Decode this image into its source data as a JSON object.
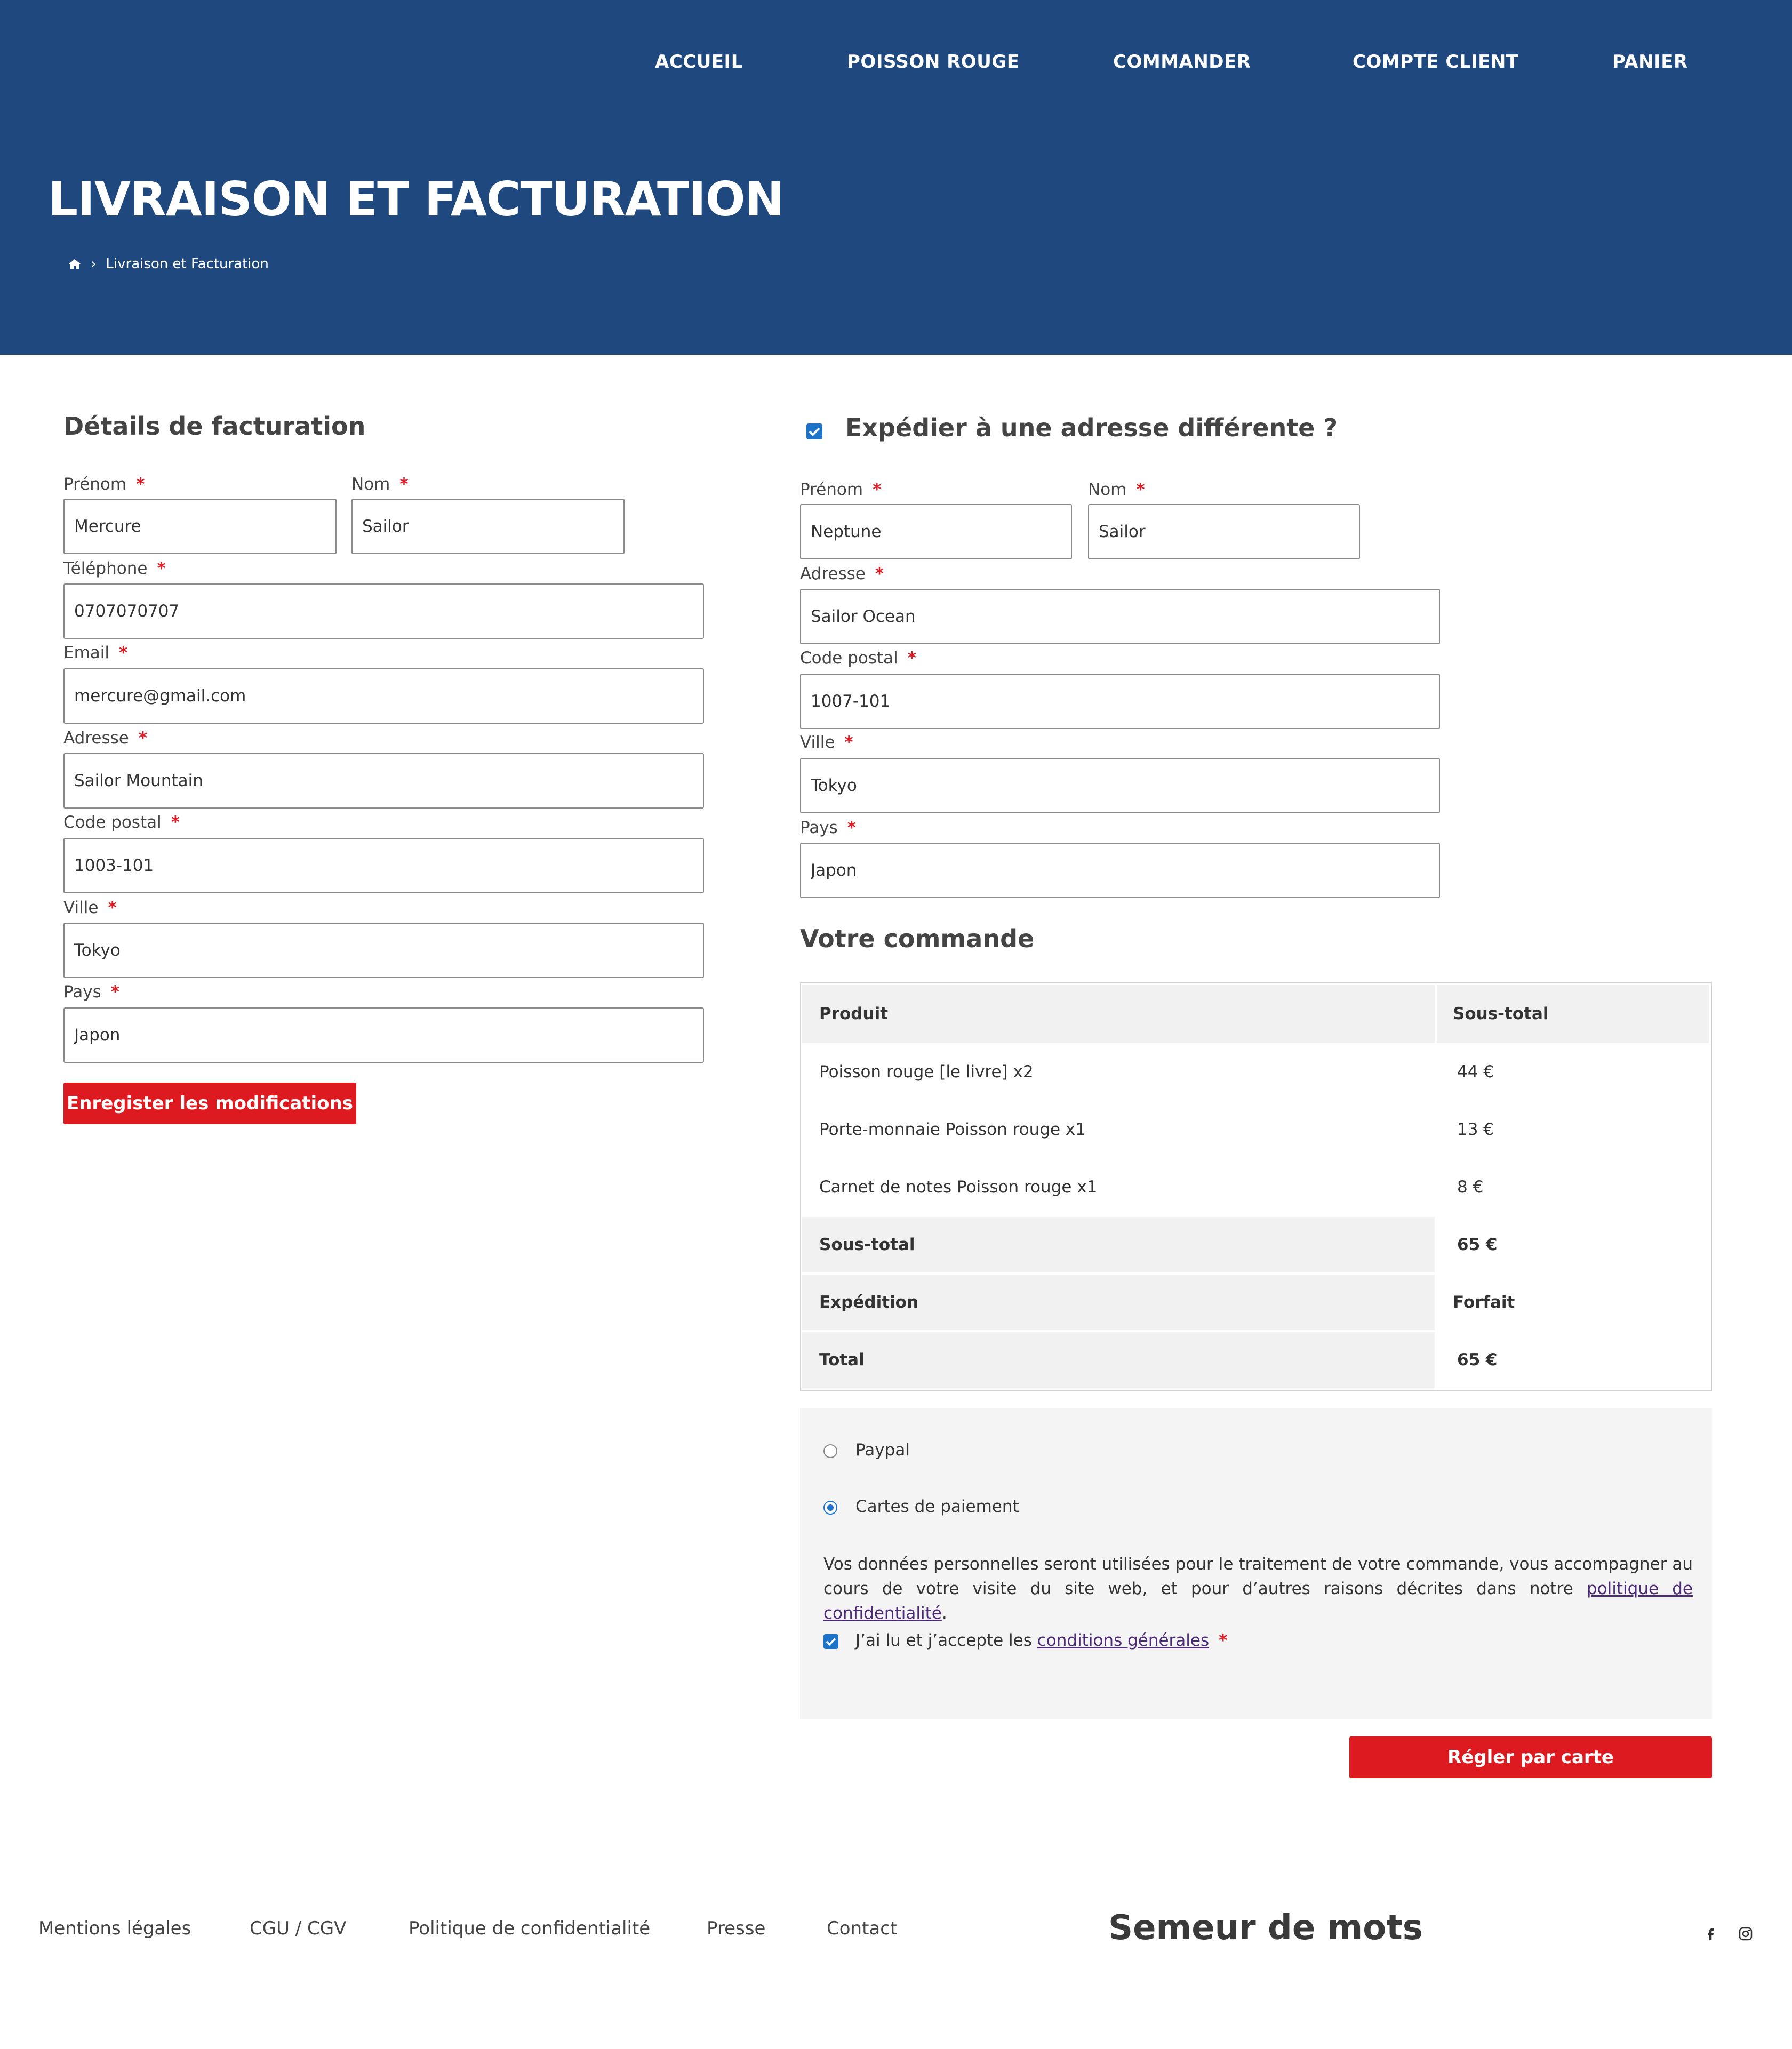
{
  "nav": {
    "items": [
      "ACCUEIL",
      "POISSON ROUGE",
      "COMMANDER",
      "COMPTE CLIENT",
      "PANIER"
    ]
  },
  "hero": {
    "title": "LIVRAISON ET FACTURATION",
    "breadcrumb_current": "Livraison et Facturation",
    "home_icon": "home-icon"
  },
  "billing": {
    "heading": "Détails de facturation",
    "required_mark": "*",
    "fields": {
      "prenom": {
        "label": "Prénom",
        "value": "Mercure"
      },
      "nom": {
        "label": "Nom",
        "value": "Sailor"
      },
      "telephone": {
        "label": "Téléphone",
        "value": "0707070707"
      },
      "email": {
        "label": "Email",
        "value": "mercure@gmail.com"
      },
      "adresse": {
        "label": "Adresse",
        "value": "Sailor Mountain"
      },
      "code_postal": {
        "label": "Code postal",
        "value": "1003-101"
      },
      "ville": {
        "label": "Ville",
        "value": "Tokyo"
      },
      "pays": {
        "label": "Pays",
        "value": "Japon"
      }
    },
    "save_button": "Enregister les modifications"
  },
  "shipping": {
    "heading": "Expédier à une adresse différente ?",
    "checked": true,
    "fields": {
      "prenom": {
        "label": "Prénom",
        "value": "Neptune"
      },
      "nom": {
        "label": "Nom",
        "value": "Sailor"
      },
      "adresse": {
        "label": "Adresse",
        "value": "Sailor Ocean"
      },
      "code_postal": {
        "label": "Code postal",
        "value": "1007-101"
      },
      "ville": {
        "label": "Ville",
        "value": "Tokyo"
      },
      "pays": {
        "label": "Pays",
        "value": "Japon"
      }
    }
  },
  "order": {
    "heading": "Votre commande",
    "columns": [
      "Produit",
      "Sous-total"
    ],
    "items": [
      {
        "product": "Poisson rouge [le livre] x2",
        "subtotal": "44 €"
      },
      {
        "product": "Porte-monnaie Poisson rouge x1",
        "subtotal": "13 €"
      },
      {
        "product": "Carnet de notes Poisson rouge x1",
        "subtotal": "8 €"
      }
    ],
    "totals": [
      {
        "label": "Sous-total",
        "value": "65 €"
      },
      {
        "label": "Expédition",
        "value": "Forfait"
      },
      {
        "label": "Total",
        "value": "65 €"
      }
    ]
  },
  "payment": {
    "methods": [
      {
        "label": "Paypal",
        "selected": false
      },
      {
        "label": "Cartes de paiement",
        "selected": true
      }
    ],
    "privacy_text": "Vos données personnelles seront utilisées pour le traitement de votre commande, vous accompagner au cours de votre visite du site web, et pour d’autres raisons décrites dans notre",
    "privacy_link": "politique de confidentialité",
    "privacy_end": ".",
    "terms_prefix": "J’ai lu et j’accepte les",
    "terms_link": "conditions générales",
    "terms_checked": true,
    "pay_button": "Régler  par carte"
  },
  "footer": {
    "links": [
      "Mentions légales",
      "CGU / CGV",
      "Politique de confidentialité",
      "Presse",
      "Contact"
    ],
    "brand": "Semeur de mots",
    "social_icons": [
      "facebook-icon",
      "instagram-icon"
    ]
  },
  "colors": {
    "header_bg": "#1f487e",
    "accent_red": "#dd1a1f",
    "checkbox_blue": "#1d73c9",
    "link_purple": "#4b2a78"
  }
}
